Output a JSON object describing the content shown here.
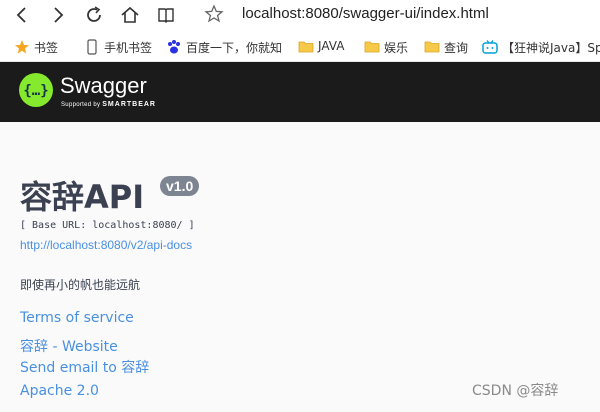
{
  "browser": {
    "url": "localhost:8080/swagger-ui/index.html",
    "bookmarks": [
      {
        "label": "书签",
        "icon": "star-icon"
      },
      {
        "label": "手机书签",
        "icon": "phone-icon"
      },
      {
        "label": "百度一下，你就知",
        "icon": "baidu-paw-icon"
      },
      {
        "label": "JAVA",
        "icon": "folder-icon"
      },
      {
        "label": "娱乐",
        "icon": "folder-icon"
      },
      {
        "label": "查询",
        "icon": "folder-icon"
      },
      {
        "label": "【狂神说Java】Sp",
        "icon": "bilibili-icon"
      }
    ]
  },
  "topbar": {
    "logo_title": "Swagger",
    "logo_sub_prefix": "Supported by",
    "logo_sub_brand": "SMARTBEAR",
    "logo_color": "#85ea2d"
  },
  "info": {
    "title": "容辞API",
    "version": "v1.0",
    "base_url": "[ Base URL: localhost:8080/ ]",
    "docs_link": "http://localhost:8080/v2/api-docs",
    "description": "即使再小的帆也能远航",
    "terms": "Terms of service",
    "website": "容辞 - Website",
    "email": "Send email to 容辞",
    "license": "Apache 2.0"
  },
  "watermark": "CSDN @容辞"
}
